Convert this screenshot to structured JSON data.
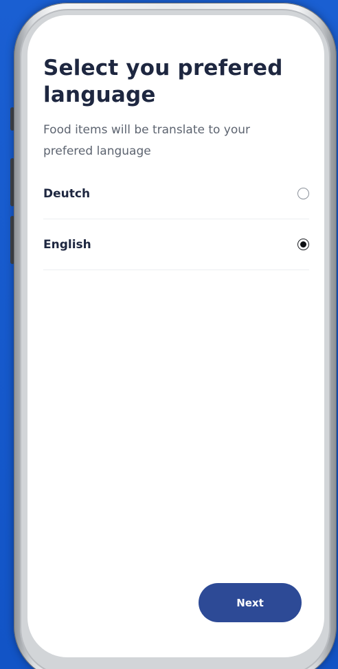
{
  "screen": {
    "title": "Select you prefered language",
    "subtitle": "Food items will be translate to your prefered language"
  },
  "languages": [
    {
      "label": "Deutch",
      "selected": false
    },
    {
      "label": "English",
      "selected": true
    }
  ],
  "actions": {
    "next_label": "Next"
  },
  "colors": {
    "background": "#1456c8",
    "title_text": "#1e2740",
    "body_text": "#5d6470",
    "button": "#2d4a96",
    "button_text": "#ffffff"
  }
}
